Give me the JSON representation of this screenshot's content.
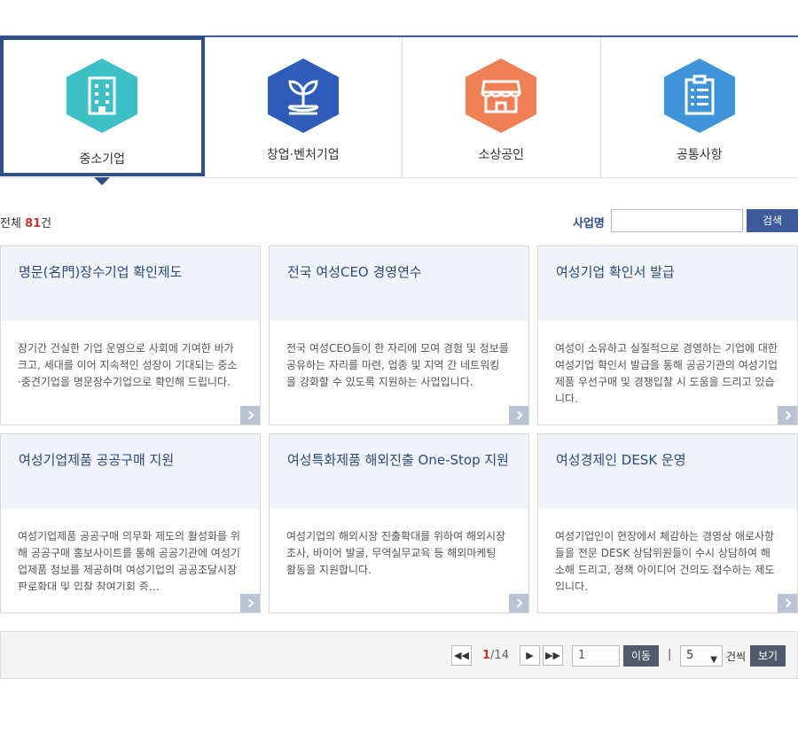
{
  "tabs": [
    {
      "label": "중소기업",
      "icon": "building-icon",
      "color": "#3cbfc5",
      "active": true
    },
    {
      "label": "창업·벤처기업",
      "icon": "sprout-icon",
      "color": "#2e5cb8",
      "active": false
    },
    {
      "label": "소상공인",
      "icon": "store-icon",
      "color": "#ef7f55",
      "active": false
    },
    {
      "label": "공통사항",
      "icon": "clipboard-icon",
      "color": "#3f94d9",
      "active": false
    }
  ],
  "summary": {
    "prefix": "전체 ",
    "count": "81",
    "suffix": "건"
  },
  "search": {
    "label": "사업명",
    "value": "",
    "button": "검색"
  },
  "cards": [
    {
      "title": "명문(名門)장수기업 확인제도",
      "desc": "장기간 건실한 기업 운영으로 사회에 기여한 바가 크고, 세대를 이어 지속적인 성장이 기대되는 중소·중견기업을 명문장수기업으로 확인해 드립니다."
    },
    {
      "title": "전국 여성CEO 경영연수",
      "desc": "전국 여성CEO들이 한 자리에 모여 경험 및 정보를 공유하는 자리를 마련, 업종 및 지역 간 네트워킹을 강화할 수 있도록 지원하는 사업입니다."
    },
    {
      "title": "여성기업 확인서 발급",
      "desc": "여성이 소유하고 실질적으로 경영하는 기업에 대한 여성기업 확인서 발급을 통해 공공기관의 여성기업제품 우선구매 및 경쟁입찰 시 도움을 드리고 있습니다."
    },
    {
      "title": "여성기업제품 공공구매 지원",
      "desc": "여성기업제품 공공구매 의무화 제도의 활성화를 위해 공공구매 홍보사이트를 통해 공공기관에 여성기업제품 정보를 제공하며 여성기업의 공공조달시장 판로확대 및 입찰 참여기회 증…"
    },
    {
      "title": "여성특화제품 해외진출 One-Stop 지원",
      "desc": "여성기업의 해외시장 진출확대를 위하여 해외시장조사, 바이어 발굴, 무역실무교육 등 해외마케팅 활동을 지원합니다."
    },
    {
      "title": "여성경제인 DESK 운영",
      "desc": "여성기업인이 현장에서 체감하는 경영상 애로사항들을 전문 DESK 상담위원들이 수시 상담하여 해소해 드리고, 정책 아이디어 건의도 접수하는 제도입니다."
    }
  ],
  "pager": {
    "first": "◀◀",
    "prev": "◀",
    "next": "▶",
    "last": "▶▶",
    "current": "1",
    "total": "/14",
    "go_value": "1",
    "go_button": "이동",
    "separator": "|",
    "per_page": "5",
    "per_page_unit": "건씩",
    "view_button": "보기"
  },
  "colors": {
    "accent": "#2e4f8c",
    "highlight": "#c0392b",
    "card_head_bg": "#f0f3f7"
  }
}
